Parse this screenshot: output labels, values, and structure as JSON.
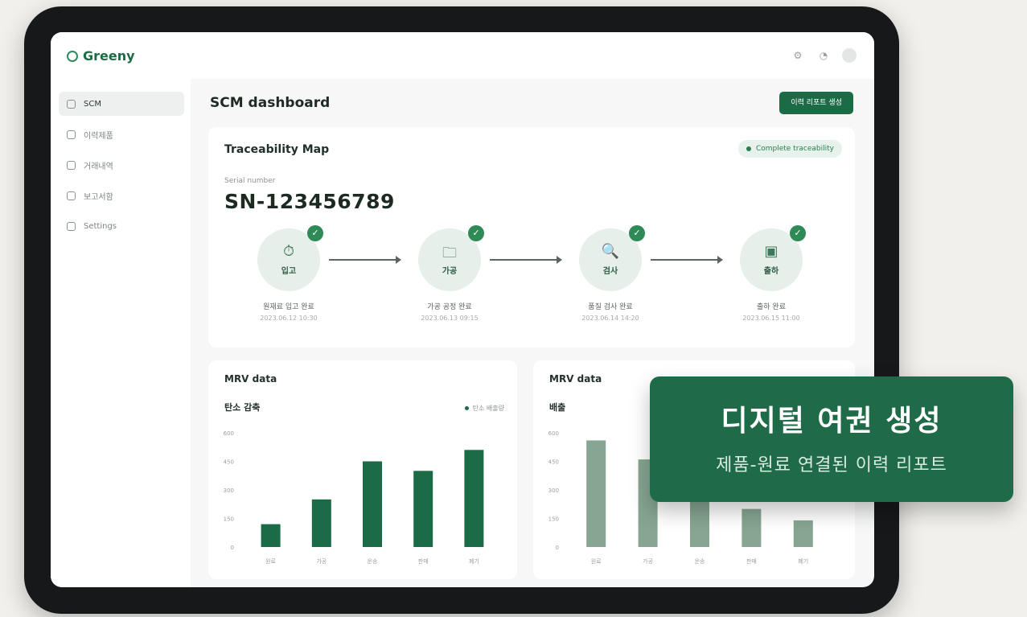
{
  "app": {
    "name": "Greeny"
  },
  "sidebar": {
    "items": [
      {
        "label": "SCM",
        "active": true
      },
      {
        "label": "이력제품"
      },
      {
        "label": "거래내역"
      },
      {
        "label": "보고서함"
      },
      {
        "label": "Settings"
      }
    ]
  },
  "header": {
    "title": "SCM dashboard",
    "action_label": "이력 리포트 생성"
  },
  "trace": {
    "title": "Traceability Map",
    "badge": "Complete traceability",
    "serial_label": "Serial number",
    "serial": "SN-123456789",
    "steps": [
      {
        "label": "입고",
        "icon": "⏱",
        "desc": "원재료 입고 완료",
        "date": "2023.06.12 10:30"
      },
      {
        "label": "가공",
        "icon": "🗀",
        "desc": "가공 공정 완료",
        "date": "2023.06.13 09:15"
      },
      {
        "label": "검사",
        "icon": "🔍",
        "desc": "품질 검사 완료",
        "date": "2023.06.14 14:20"
      },
      {
        "label": "출하",
        "icon": "▣",
        "desc": "출하 완료",
        "date": "2023.06.15 11:00"
      }
    ]
  },
  "charts": {
    "left": {
      "title": "MRV data",
      "subtitle": "탄소 감축",
      "legend": "탄소 배출량"
    },
    "right": {
      "title": "MRV data",
      "subtitle": "배출"
    }
  },
  "chart_data": [
    {
      "type": "bar",
      "title": "MRV data",
      "categories": [
        "원료",
        "가공",
        "운송",
        "판매",
        "폐기"
      ],
      "values": [
        120,
        250,
        450,
        400,
        510
      ],
      "ylim": [
        0,
        600
      ],
      "yticks": [
        0,
        150,
        300,
        450,
        600
      ],
      "color": "#1c6b47"
    },
    {
      "type": "bar",
      "title": "MRV data",
      "categories": [
        "원료",
        "가공",
        "운송",
        "판매",
        "폐기"
      ],
      "values": [
        560,
        460,
        390,
        200,
        140
      ],
      "ylim": [
        0,
        600
      ],
      "yticks": [
        0,
        150,
        300,
        450,
        600
      ],
      "color": "#86a592"
    }
  ],
  "banner": {
    "title": "디지털 여권 생성",
    "subtitle": "제품-원료 연결된 이력 리포트"
  },
  "colors": {
    "brand": "#1c6b47",
    "accent": "#2f8a58"
  }
}
